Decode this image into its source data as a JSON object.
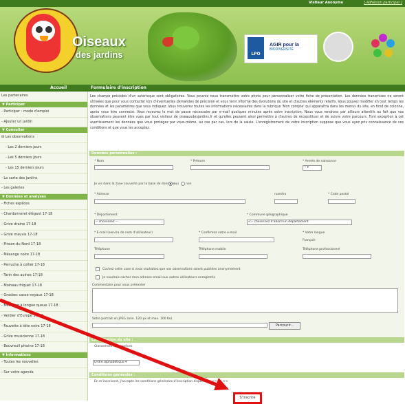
{
  "topbar": {
    "visitor": "Visiteur Anonyme",
    "signin": "[ Adhésion participer ]"
  },
  "header": {
    "brand_line1": "Oiseaux",
    "brand_line2": "des jardins",
    "lpo": "LPO",
    "agir": "AGIR pour la",
    "agir_sub": "BIODIVERSITÉ"
  },
  "nav": {
    "home": "Accueil",
    "title": "Formulaire d'inscription"
  },
  "sidebar": {
    "items": [
      {
        "type": "item",
        "label": "Les partenaires"
      },
      {
        "type": "head",
        "label": "▼ Participer"
      },
      {
        "type": "item",
        "label": "- Participer : mode d'emploi"
      },
      {
        "type": "item",
        "label": "- Ajouter un jardin"
      },
      {
        "type": "head",
        "label": "▼ Consulter"
      },
      {
        "type": "item",
        "label": "⊟ Les observations"
      },
      {
        "type": "sub",
        "label": "- Les 2 derniers jours"
      },
      {
        "type": "sub",
        "label": "- Les 5 derniers jours"
      },
      {
        "type": "sub",
        "label": "- Les 15 derniers jours"
      },
      {
        "type": "item",
        "label": "- La carte des jardins"
      },
      {
        "type": "item",
        "label": "- Les galeries"
      },
      {
        "type": "head",
        "label": "▼ Données et analyses"
      },
      {
        "type": "item",
        "label": "- Fiches espèces"
      },
      {
        "type": "item",
        "label": "- Chardonneret élégant 17-18"
      },
      {
        "type": "item",
        "label": "- Grive draine 17-18"
      },
      {
        "type": "item",
        "label": "- Grive mauvis 17-18"
      },
      {
        "type": "item",
        "label": "- Pinson du Nord 17-18"
      },
      {
        "type": "item",
        "label": "- Mésange noire 17-18"
      },
      {
        "type": "item",
        "label": "- Perruche à collier 17-18"
      },
      {
        "type": "item",
        "label": "- Tarin des aulnes 17-18"
      },
      {
        "type": "item",
        "label": "- Moineau friquet 17-18"
      },
      {
        "type": "item",
        "label": "- Grosbec casse-noyaux 17-18"
      },
      {
        "type": "item",
        "label": "- Mésange à longue queue 17-18"
      },
      {
        "type": "item",
        "label": "- Verdier d'Europe 17-18"
      },
      {
        "type": "item",
        "label": "- Fauvette à tête noire 17-18"
      },
      {
        "type": "item",
        "label": "- Grive musicienne 17-18"
      },
      {
        "type": "item",
        "label": "- Bouvreuil pivoine 17-18"
      },
      {
        "type": "head",
        "label": "▼ Informations"
      },
      {
        "type": "item",
        "label": "- Toutes les nouvelles"
      },
      {
        "type": "item",
        "label": "- Sur votre agenda"
      }
    ]
  },
  "intro": "Les champs précédés d'un astérisque sont obligatoires. Vous pouvez nous transmettre votre photo pour personnaliser votre fiche de présentation. Les données transmises ne seront utilisées que pour vous contacter lors d'éventuelles demandes de précision et vous tenir informé des évolutions du site et d'autres éléments relatifs. Vous pouvez modifier en tout temps les données et les paramètres que vous indiquez. Vous trouverez toutes les informations nécessaires dans la rubrique 'Mon compte' qui apparaîtra dans les menus du site, en fond de colonne, après vous être connecté. Vous recevrez le mot de passe nécessaire par e-mail quelques minutes après votre inscription. Nous vous rendrons par ailleurs attentifs au fait que vos observations peuvent être vues par tout visiteur de oiseauxdesjardins.fr et qu'elles peuvent ainsi permettre à d'autres de reconstituer et de suivre votre parcours. Font exception à cet avertissement les données que vous protégez par vous-même, au cas par cas, lors de la saisie. L'enregistrement de votre inscription suppose que vous ayez pris connaissance de ces conditions et que vous les acceptez.",
  "form": {
    "section_personal": "Données personnelles :",
    "nom": "* Nom",
    "prenom": "* Prénom",
    "annee": "* Année de naissance",
    "annee_value": "-- ▾",
    "zone_question": "Je vis dans la zone couverte par la base de données :",
    "oui": "oui",
    "non": "non",
    "adresse": "* Adresse",
    "numero": "numéro",
    "code_postal": "* Code postal",
    "departement": "* Département",
    "departement_value": "-- choisissez --",
    "commune": "* Commune géographique",
    "commune_value": "<-- choisissez d'abord un département",
    "email": "* E-mail (servira de nom d'utilisateur)",
    "confirm_email": "* Confirmez votre e-mail",
    "langue": "* Votre langue",
    "langue_value": "Français",
    "telephone": "Téléphone",
    "tel_mobile": "Téléphone mobile",
    "tel_pro": "Téléphone professionnel",
    "anon_checkbox": "Cochez cette case si vous souhaitez que vos observations soient publiées anonymement",
    "hide_email": "Je voudrais cacher mon adresse email aux autres utilisateurs enregistrés",
    "comment": "Commentaire pour vous présenter",
    "portrait": "Votre portrait en JPEG (min. 120 px et max. 100 Ko)",
    "browse": "Parcourir...",
    "section_consult": "Consultation du site :",
    "classement": "Classement des espèces",
    "classement_value": "Ordre alphabétique ▾",
    "section_cond": "Conditions générales :",
    "cond_text": "En m'inscrivant, j'accepte les conditions générales d'inscription disponibles >> ici <<",
    "submit": "S'inscrire"
  },
  "colors": {
    "green_dark": "#3f7a1f",
    "green_light": "#b8d68e",
    "highlight": "#e01010"
  }
}
